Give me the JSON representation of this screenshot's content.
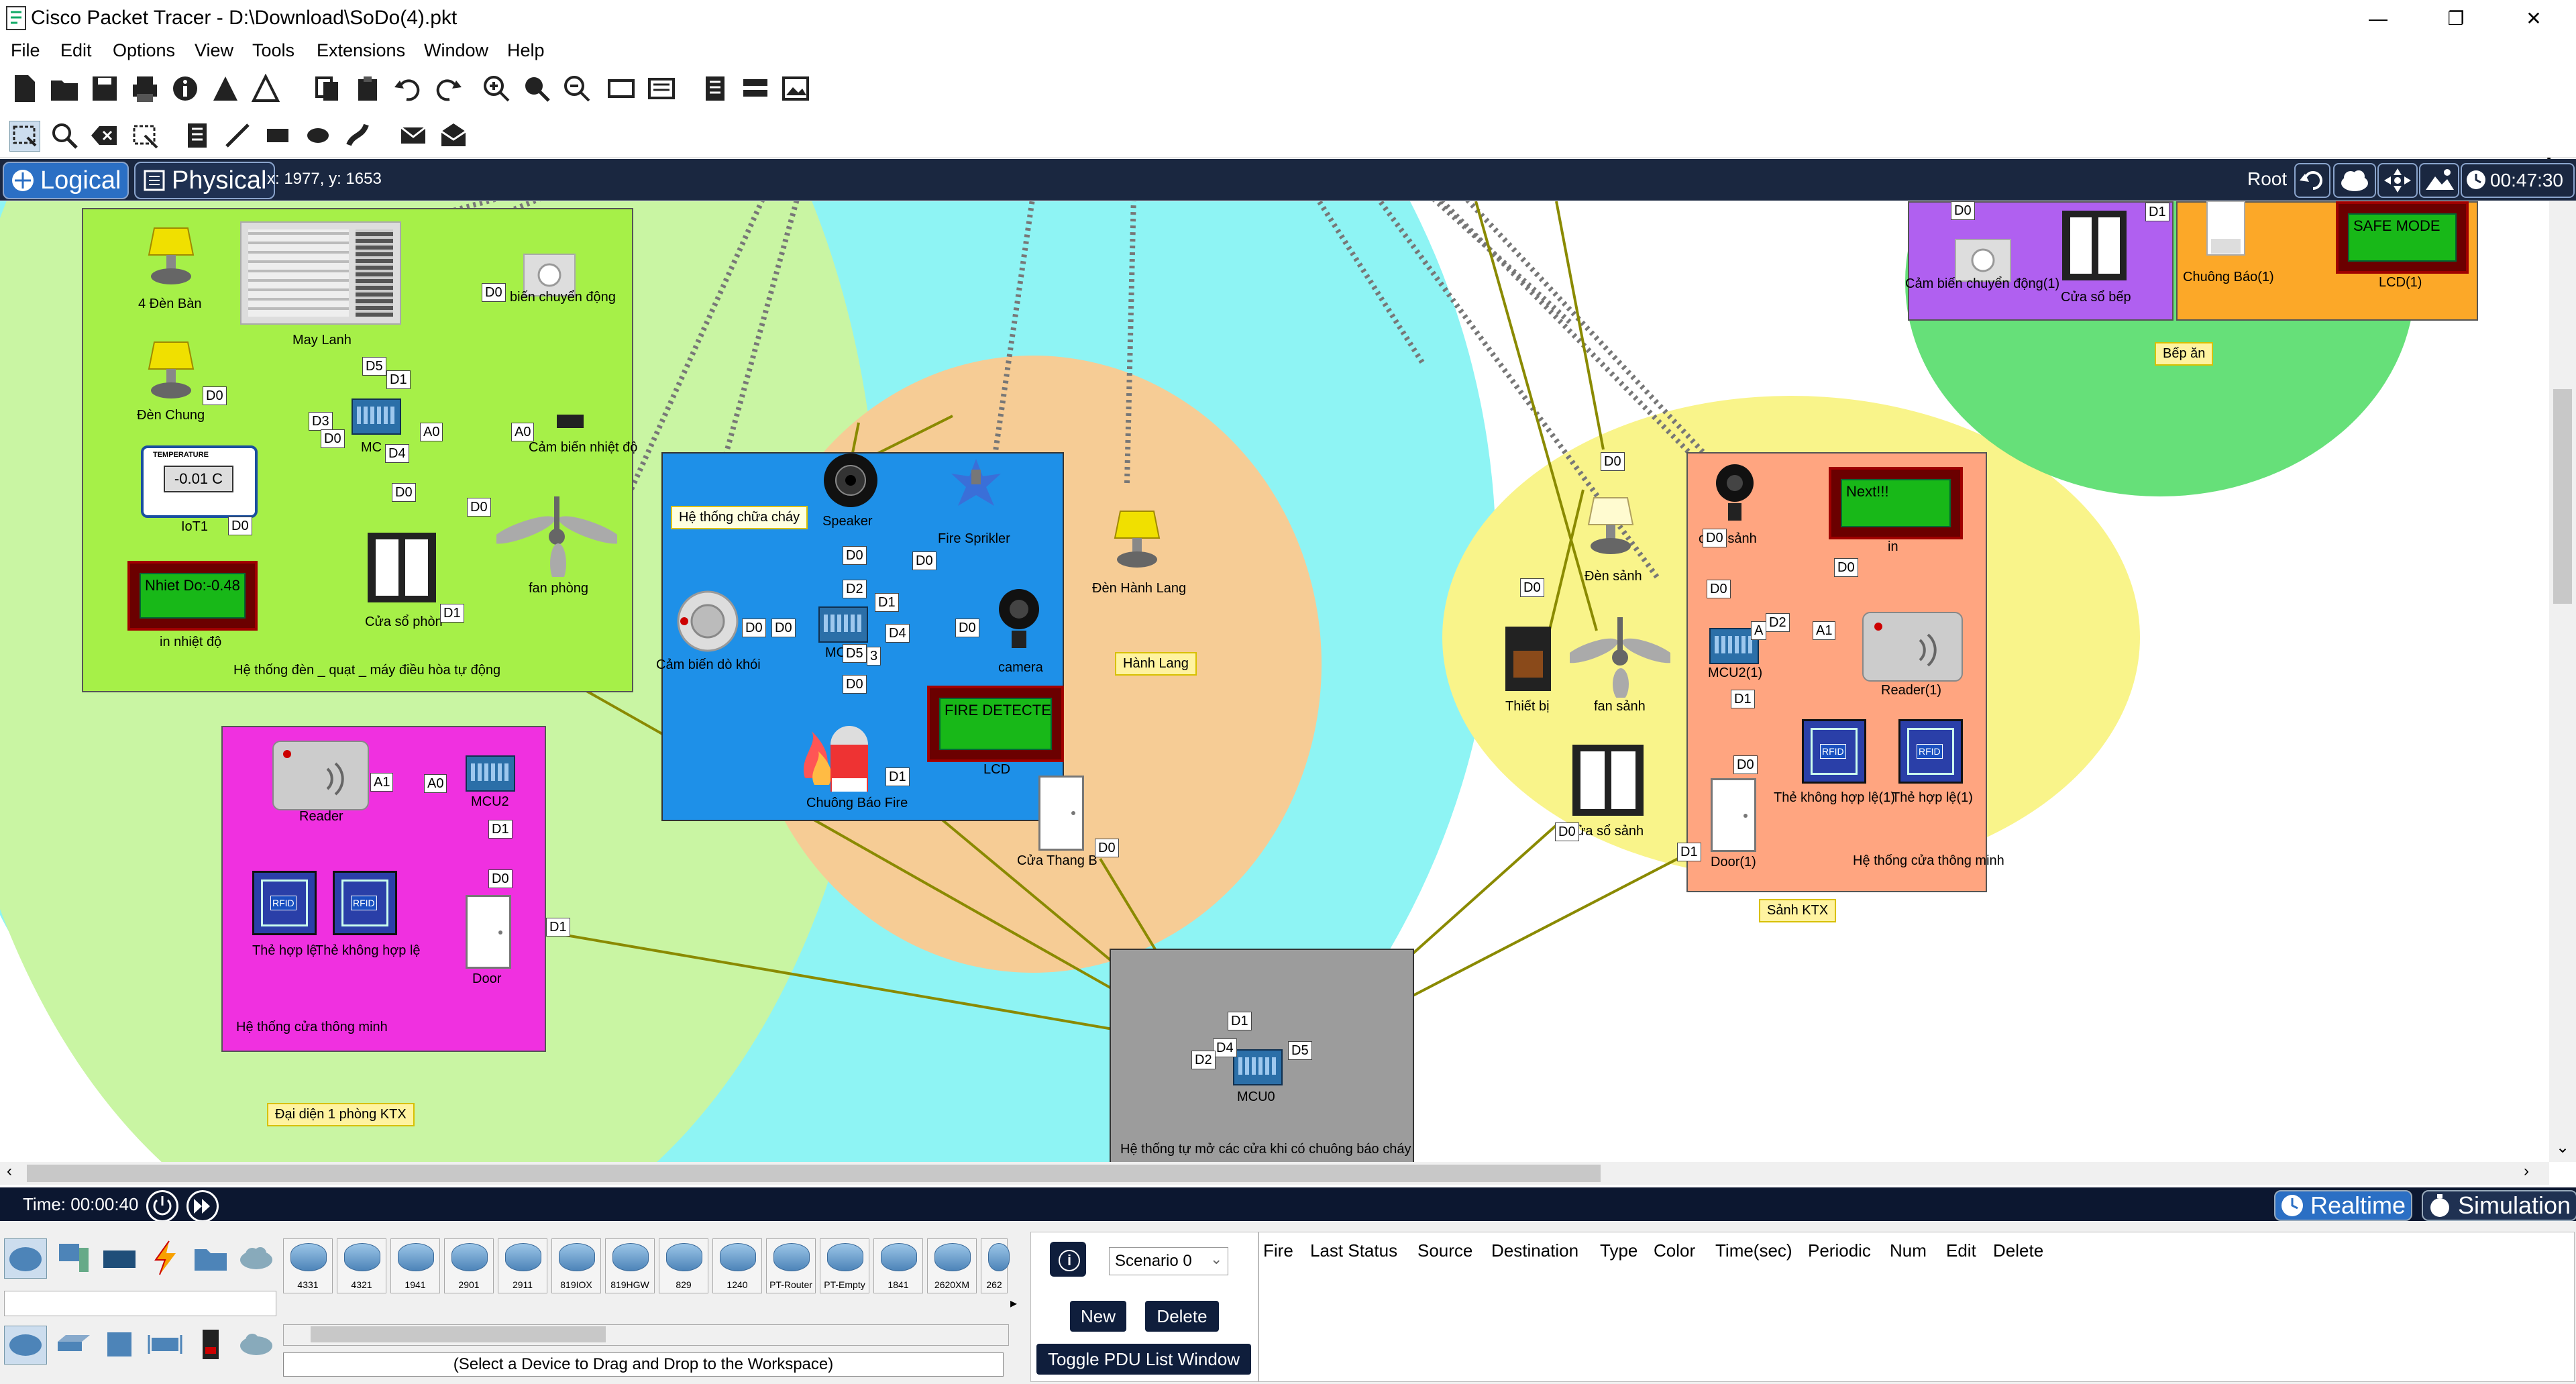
{
  "window": {
    "title": "Cisco Packet Tracer - D:\\Download\\SoDo(4).pkt",
    "minimize": "—",
    "restore": "❐",
    "close": "✕"
  },
  "menu": [
    "File",
    "Edit",
    "Options",
    "View",
    "Tools",
    "Extensions",
    "Window",
    "Help"
  ],
  "help_icon": "?",
  "nav": {
    "logical": "Logical",
    "physical": "Physical",
    "coords": "x: 1977, y: 1653",
    "root": "Root",
    "clock": "00:47:30"
  },
  "workspace": {
    "room": {
      "lamp4": "4 Đèn Bàn",
      "ac": "May Lanh",
      "motion": "biến chuyển động",
      "lamp_common": "Đèn Chung",
      "mcu": "MC",
      "temp_sensor": "Cảm biến nhiệt độ",
      "iot_value": "-0.01 C",
      "iot_header": "TEMPERATURE",
      "iot": "IoT1",
      "lcd_text": "Nhiet Do:-0.48",
      "lcd": "in nhiệt độ",
      "window": "Cửa sổ phòn",
      "fan": "fan phòng",
      "system": "Hệ thống đèn _ quạt _ máy điều hòa tự động",
      "ports": [
        "D0",
        "D5",
        "D1",
        "D0",
        "D3",
        "D0",
        "A0",
        "A0",
        "D4",
        "D0",
        "D0",
        "D0",
        "D1"
      ]
    },
    "door_room": {
      "reader": "Reader",
      "mcu": "MCU2",
      "valid": "Thẻ hợp lệ",
      "invalid": "Thẻ không hợp lệ",
      "door": "Door",
      "system": "Hệ thống cửa thông minh",
      "rfid": "RFID",
      "ports": [
        "A1",
        "A0",
        "D1",
        "D0",
        "D1"
      ]
    },
    "room_area": "Đại diện 1 phòng KTX",
    "fire": {
      "label": "Hệ thống chữa cháy",
      "speaker": "Speaker",
      "sprinkler": "Fire Sprikler",
      "smoke": "Cảm biến dò khói",
      "mcu": "MC",
      "camera": "camera",
      "lcd_text": "FIRE DETECTED",
      "lcd": "LCD",
      "alarm": "Chuông Báo Fire",
      "ports": [
        "D0",
        "D0",
        "D2",
        "D1",
        "D0",
        "D0",
        "D0",
        "D5",
        "D4",
        "D0",
        "D1",
        "3"
      ]
    },
    "hall": {
      "lamp": "Đèn Hành Lang",
      "label": "Hành Lang",
      "door": "Cửa Thang B",
      "door_port": "D0"
    },
    "mcu0": {
      "name": "MCU0",
      "system": "Hệ thống tự mở các cửa khi có chuông báo cháy",
      "ports": [
        "D1",
        "D4",
        "D2",
        "D5"
      ]
    },
    "lobby": {
      "camera": "ca a sảnh",
      "lamp": "Đèn sảnh",
      "lcd_text": "Next!!!",
      "lcd": "in",
      "device": "Thiết bị",
      "fan": "fan sảnh",
      "mcu": "MCU2(1)",
      "reader": "Reader(1)",
      "invalid": "Thẻ không hợp lệ(1)",
      "valid": "Thẻ hợp lệ(1)",
      "window": "ửa sổ sảnh",
      "door": "Door(1)",
      "system": "Hệ thống cửa thông minh",
      "label": "Sảnh KTX",
      "ports": [
        "D0",
        "D0",
        "D0",
        "D0",
        "A",
        "D2",
        "A1",
        "D0",
        "D1",
        "D0",
        "D0",
        "D1"
      ]
    },
    "kitchen": {
      "motion": "Cảm biến chuyển động(1)",
      "window": "Cửa sổ bếp",
      "alarm": "Chuông Báo(1)",
      "lcd_text": "SAFE MODE",
      "lcd": "LCD(1)",
      "label": "Bếp ăn",
      "ports": [
        "D0",
        "D1"
      ]
    }
  },
  "timebar": {
    "time": "Time: 00:00:40",
    "realtime": "Realtime",
    "simulation": "Simulation"
  },
  "devices": [
    "4331",
    "4321",
    "1941",
    "2901",
    "2911",
    "819IOX",
    "819HGW",
    "829",
    "1240",
    "PT-Router",
    "PT-Empty",
    "1841",
    "2620XM",
    "262"
  ],
  "device_hint": "(Select a Device to Drag and Drop to the Workspace)",
  "scenario": {
    "info": "i",
    "name": "Scenario 0",
    "new": "New",
    "delete": "Delete",
    "toggle": "Toggle PDU List Window"
  },
  "pdu_headers": [
    "Fire",
    "Last Status",
    "Source",
    "Destination",
    "Type",
    "Color",
    "Time(sec)",
    "Periodic",
    "Num",
    "Edit",
    "Delete"
  ],
  "colors": {
    "nav_bg": "#1a2740",
    "accent": "#2b6fc4",
    "cable": "#8a8a00",
    "room_zone": "#a0f070",
    "fire_zone": "#1e90e8",
    "lobby_zone": "#ffa580"
  }
}
